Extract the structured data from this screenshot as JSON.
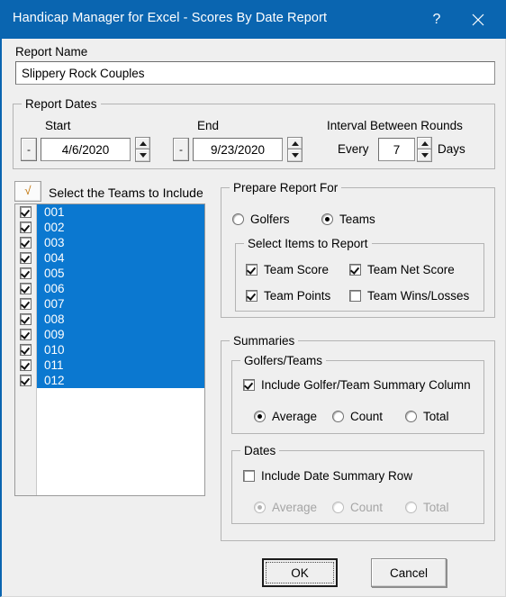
{
  "window": {
    "title": "Handicap Manager for Excel - Scores By Date Report",
    "help_label": "?",
    "close_label": "✕",
    "titlebar_color": "#0a65b0"
  },
  "report_name": {
    "label": "Report Name",
    "value": "Slippery Rock Couples",
    "placeholder": ""
  },
  "report_dates": {
    "title": "Report Dates",
    "start": {
      "label": "Start",
      "dropdown_label": "-",
      "value": "4/6/2020"
    },
    "end": {
      "label": "End",
      "dropdown_label": "-",
      "value": "9/23/2020"
    },
    "interval": {
      "title": "Interval Between Rounds",
      "prefix_label": "Every",
      "value": "7",
      "suffix_label": "Days"
    }
  },
  "teams": {
    "select_all_glyph": "√",
    "header_label": "Select the Teams to Include",
    "items": [
      {
        "label": "001",
        "checked": true,
        "selected": true
      },
      {
        "label": "002",
        "checked": true,
        "selected": true
      },
      {
        "label": "003",
        "checked": true,
        "selected": true
      },
      {
        "label": "004",
        "checked": true,
        "selected": true
      },
      {
        "label": "005",
        "checked": true,
        "selected": true
      },
      {
        "label": "006",
        "checked": true,
        "selected": true
      },
      {
        "label": "007",
        "checked": true,
        "selected": true
      },
      {
        "label": "008",
        "checked": true,
        "selected": true
      },
      {
        "label": "009",
        "checked": true,
        "selected": true
      },
      {
        "label": "010",
        "checked": true,
        "selected": true
      },
      {
        "label": "011",
        "checked": true,
        "selected": true
      },
      {
        "label": "012",
        "checked": true,
        "selected": true
      }
    ],
    "selection_color": "#0b78d0"
  },
  "prepare_report_for": {
    "title": "Prepare Report For",
    "golfers_label": "Golfers",
    "golfers_selected": false,
    "teams_label": "Teams",
    "teams_selected": true,
    "items_group": {
      "title": "Select Items to Report",
      "team_score_label": "Team Score",
      "team_score_checked": true,
      "team_net_score_label": "Team Net Score",
      "team_net_score_checked": true,
      "team_points_label": "Team Points",
      "team_points_checked": true,
      "team_wins_losses_label": "Team Wins/Losses",
      "team_wins_losses_checked": false
    }
  },
  "summaries": {
    "title": "Summaries",
    "golfers_teams": {
      "title": "Golfers/Teams",
      "include_label": "Include Golfer/Team Summary Column",
      "include_checked": true,
      "average_label": "Average",
      "count_label": "Count",
      "total_label": "Total",
      "selected": "Average"
    },
    "dates": {
      "title": "Dates",
      "include_label": "Include Date Summary Row",
      "include_checked": false,
      "average_label": "Average",
      "count_label": "Count",
      "total_label": "Total",
      "selected": "Average",
      "disabled": true
    }
  },
  "buttons": {
    "ok_label": "OK",
    "cancel_label": "Cancel"
  }
}
